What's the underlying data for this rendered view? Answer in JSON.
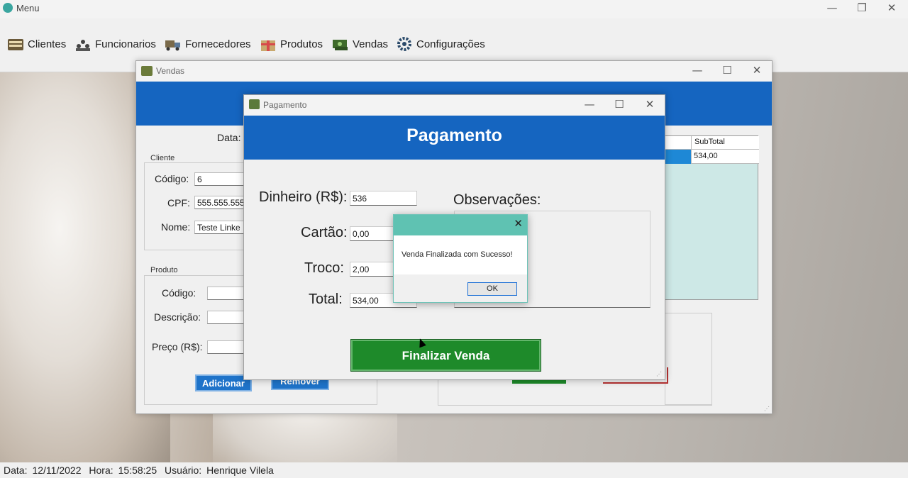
{
  "main_window": {
    "title": "Menu",
    "controls": {
      "minimize": "—",
      "maximize": "❐",
      "close": "✕"
    }
  },
  "menubar": {
    "items": [
      {
        "label": "Clientes",
        "icon": "clients-icon"
      },
      {
        "label": "Funcionarios",
        "icon": "employees-icon"
      },
      {
        "label": "Fornecedores",
        "icon": "suppliers-icon"
      },
      {
        "label": "Produtos",
        "icon": "products-icon"
      },
      {
        "label": "Vendas",
        "icon": "sales-icon"
      },
      {
        "label": "Configurações",
        "icon": "gear-icon"
      }
    ]
  },
  "vendas_window": {
    "title": "Vendas",
    "controls": {
      "minimize": "—",
      "maximize": "☐",
      "close": "✕"
    },
    "data_label": "Data:",
    "cliente_group": "Cliente",
    "cliente": {
      "codigo_label": "Código:",
      "codigo_value": "6",
      "cpf_label": "CPF:",
      "cpf_value": "555.555.555-",
      "nome_label": "Nome:",
      "nome_value": "Teste Linke"
    },
    "produto_group": "Produto",
    "produto": {
      "codigo_label": "Código:",
      "codigo_value": "",
      "descricao_label": "Descrição:",
      "descricao_value": "",
      "preco_label": "Preço (R$):",
      "preco_value": ""
    },
    "grid": {
      "column_header": "SubTotal",
      "row_value": "534,00"
    },
    "buttons": {
      "adicionar": "Adicionar",
      "remover": "Remover"
    }
  },
  "pagamento_window": {
    "title": "Pagamento",
    "header": "Pagamento",
    "controls": {
      "minimize": "—",
      "maximize": "☐",
      "close": "✕"
    },
    "dinheiro_label": "Dinheiro (R$):",
    "dinheiro_value": "536",
    "cartao_label": "Cartão:",
    "cartao_value": "0,00",
    "troco_label": "Troco:",
    "troco_value": "2,00",
    "total_label": "Total:",
    "total_value": "534,00",
    "observacoes_label": "Observações:",
    "finalizar_button": "Finalizar Venda"
  },
  "message_box": {
    "message": "Venda Finalizada com Sucesso!",
    "ok_button": "OK",
    "close": "✕"
  },
  "statusbar": {
    "data_label": "Data:",
    "data_value": "12/11/2022",
    "hora_label": "Hora:",
    "hora_value": "15:58:25",
    "usuario_label": "Usuário:",
    "usuario_value": "Henrique Vilela"
  },
  "colors": {
    "header_blue": "#1565c0",
    "finalizar_green": "#1e8a2a",
    "msgbox_teal": "#5fc2b2"
  }
}
